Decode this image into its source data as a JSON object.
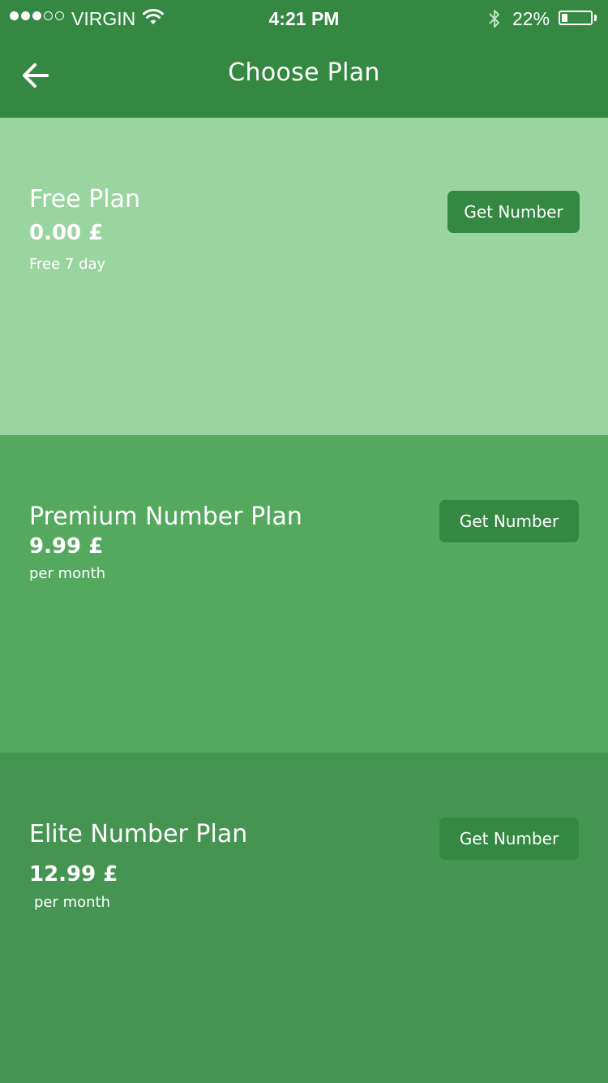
{
  "status_bar": {
    "carrier": "VIRGIN",
    "time": "4:21 PM",
    "battery_percent": "22%",
    "battery_level": 0.22,
    "signal_bars_filled": 3,
    "signal_bars_total": 5
  },
  "header": {
    "title": "Choose Plan",
    "back_icon": "arrow-left-icon"
  },
  "colors": {
    "header": "#348841",
    "free_plan_bg": "#9AD49F",
    "premium_plan_bg": "#55A95F",
    "elite_plan_bg": "#469452",
    "button": "#348841"
  },
  "plans": [
    {
      "name": "Free Plan",
      "price": "0.00 £",
      "note": "Free 7 day",
      "button_label": "Get Number"
    },
    {
      "name": "Premium Number Plan",
      "price": "9.99 £",
      "note": "per month",
      "button_label": "Get Number"
    },
    {
      "name": "Elite Number Plan",
      "price": "12.99 £",
      "note": "per month",
      "button_label": "Get Number"
    }
  ]
}
